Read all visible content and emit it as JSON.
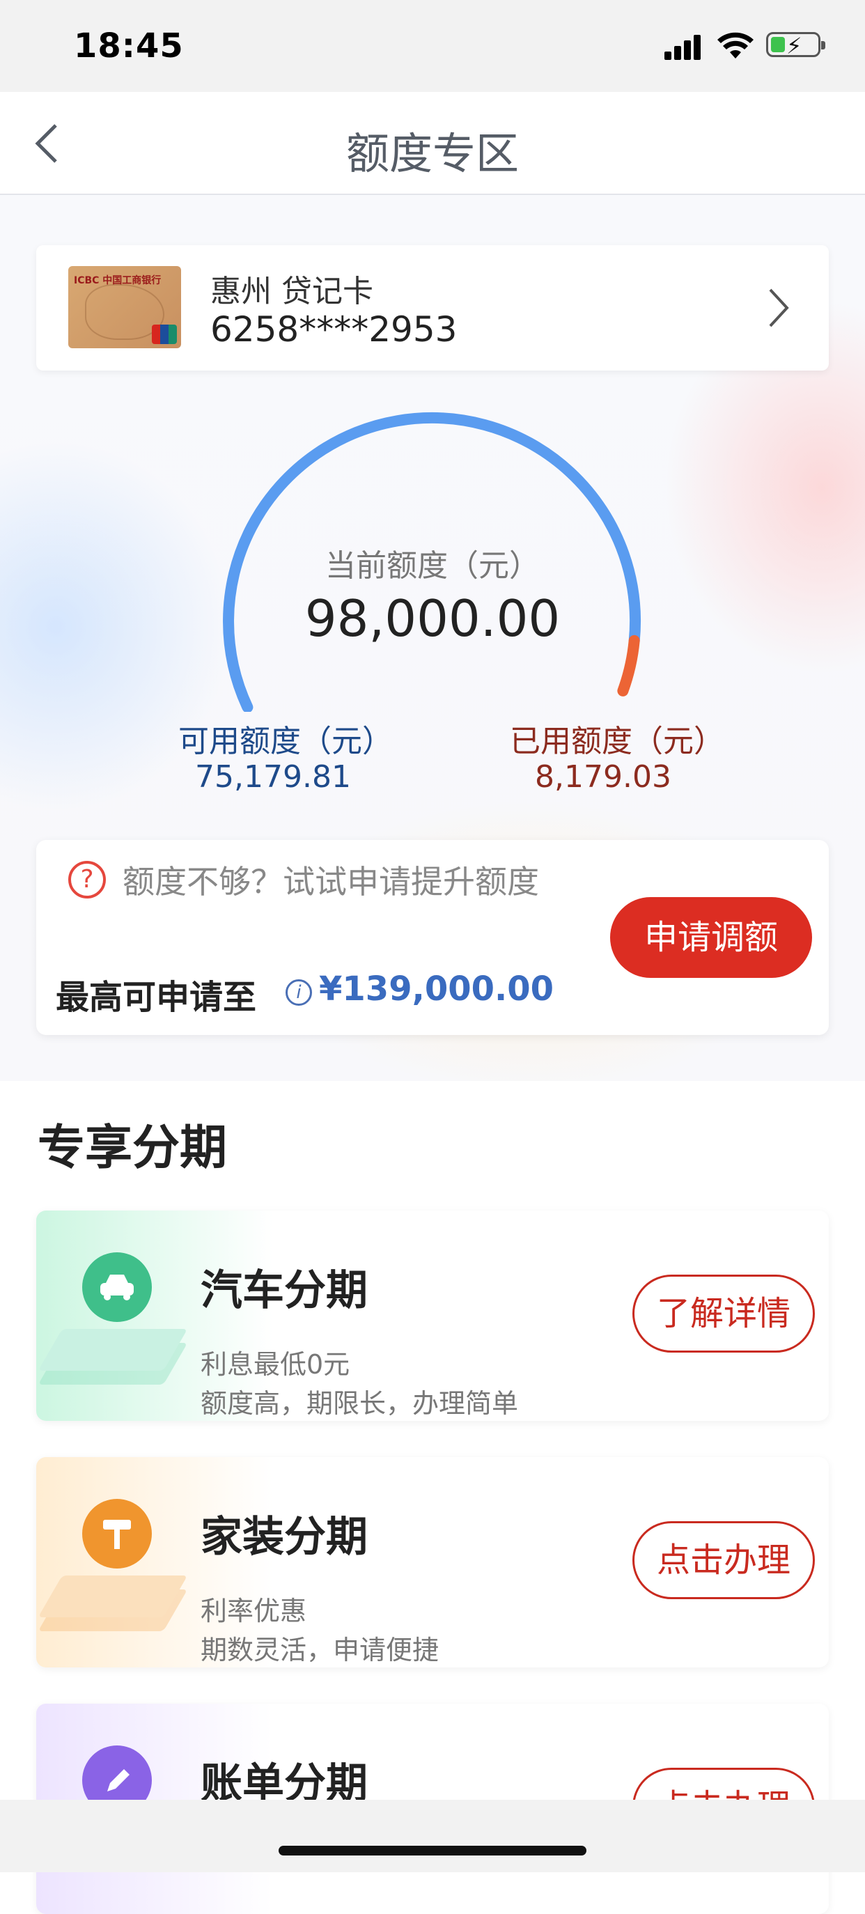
{
  "status_bar": {
    "time": "18:45"
  },
  "nav": {
    "title": "额度专区"
  },
  "card": {
    "name": "惠州 贷记卡",
    "number": "6258****2953",
    "brand_text": "ICBC 中国工商银行"
  },
  "credit": {
    "current_label": "当前额度（元）",
    "current_value": "98,000.00",
    "available_label": "可用额度（元）",
    "available_value": "75,179.81",
    "used_label": "已用额度（元）",
    "used_value": "8,179.03",
    "used_fraction": 0.083,
    "arc_color": "#5a9cf0",
    "used_color": "#ec6435"
  },
  "limit_box": {
    "prompt": "额度不够？试试申请提升额度",
    "max_label": "最高可申请至",
    "max_value": "¥139,000.00",
    "apply_button": "申请调额"
  },
  "section": {
    "title": "专享分期"
  },
  "promos": [
    {
      "title": "汽车分期",
      "line1": "利息最低0元",
      "line2": "额度高，期限长，办理简单",
      "action": "了解详情",
      "icon": "car-icon",
      "color": "#3fbf8a"
    },
    {
      "title": "家装分期",
      "line1": "利率优惠",
      "line2": "期数灵活，申请便捷",
      "action": "点击办理",
      "icon": "paint-roller-icon",
      "color": "#f0952e"
    },
    {
      "title": "账单分期",
      "action": "点击办理",
      "icon": "pencil-icon",
      "color": "#8a63e6"
    }
  ]
}
